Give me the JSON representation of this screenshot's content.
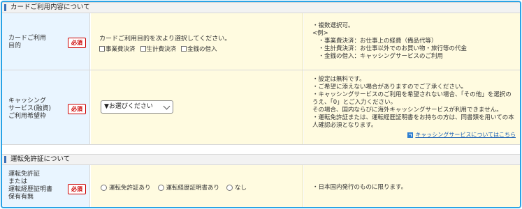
{
  "section_card": {
    "title": "カードご利用内容について"
  },
  "purpose_row": {
    "label": "カードご利用\n目的",
    "required": "必須",
    "instruction": "カードご利用目的を次より選択してください。",
    "options": [
      "事業費決済",
      "生計費決済",
      "金銭の借入"
    ],
    "note": "・複数選択可。\n<例>\n　・事業費決済：お仕事上の経費（備品代等）\n　・生計費決済：お仕事以外でのお買い物・旅行等の代金\n　・金銭の借入：キャッシングサービスのご利用"
  },
  "cashing_row": {
    "label": "キャッシング\nサービス(融資)\nご利用希望枠",
    "required": "必須",
    "select_value": "▼お選びください",
    "note": "・設定は無料です。\n・ご希望に添えない場合がありますのでご了承ください。\n・キャッシングサービスのご利用を希望されない場合、「その他」を選択の\nうえ、「0」とご入力ください。\nその場合、国内ならびに海外キャッシングサービスが利用できません。\n・運転免許証または、運転経歴証明書をお持ちの方は、同書類を用いての本\n人確認必須となります。",
    "link_text": "キャッシングサービスについてはこちら"
  },
  "section_license": {
    "title": "運転免許証について"
  },
  "license_row": {
    "label": "運転免許証\nまたは\n運転経歴証明書\n保有有無",
    "required": "必須",
    "options": [
      "運転免許証あり",
      "運転経歴証明書あり",
      "なし"
    ],
    "note": "・日本国内発行のものに限ります。"
  },
  "colors": {
    "frame": "#29a3e6",
    "label_bg": "#e9f5ff",
    "input_bg": "#fffbe0",
    "required": "#cc0000",
    "link": "#1a5fb4"
  }
}
